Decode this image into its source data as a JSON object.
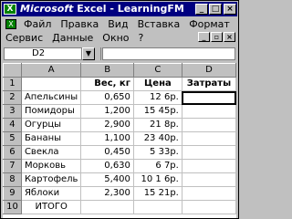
{
  "window": {
    "icon_label": "X",
    "title_brand": "Microsoft",
    "title_rest": " Excel - LearningFM",
    "btn_minimize": "_",
    "btn_maximize": "□",
    "btn_close": "×"
  },
  "menu": {
    "row1": [
      "Файл",
      "Правка",
      "Вид",
      "Вставка",
      "Формат"
    ],
    "row2": [
      "Сервис",
      "Данные",
      "Окно",
      "?"
    ],
    "doc_icon_label": "X",
    "mdi_minimize": "_",
    "mdi_restore": "▫",
    "mdi_close": "×"
  },
  "formula_bar": {
    "name_box": "D2",
    "dropdown_icon": "▼",
    "formula": ""
  },
  "grid": {
    "columns": [
      "A",
      "B",
      "C",
      "D"
    ],
    "rows": [
      {
        "num": "1",
        "cells": [
          "",
          "Вес, кг",
          "Цена",
          "Затраты"
        ]
      },
      {
        "num": "2",
        "cells": [
          "Апельсины",
          "0,650",
          "12 6р.",
          ""
        ]
      },
      {
        "num": "3",
        "cells": [
          "Помидоры",
          "1,200",
          "15 45р.",
          ""
        ]
      },
      {
        "num": "4",
        "cells": [
          "Огурцы",
          "2,900",
          "21 8р.",
          ""
        ]
      },
      {
        "num": "5",
        "cells": [
          "Бананы",
          "1,100",
          "23 40р.",
          ""
        ]
      },
      {
        "num": "6",
        "cells": [
          "Свекла",
          "0,450",
          "5 33р.",
          ""
        ]
      },
      {
        "num": "7",
        "cells": [
          "Морковь",
          "0,630",
          "6 7р.",
          ""
        ]
      },
      {
        "num": "8",
        "cells": [
          "Картофель",
          "5,400",
          "10 1 6р.",
          ""
        ]
      },
      {
        "num": "9",
        "cells": [
          "Яблоки",
          "2,300",
          "15 21р.",
          ""
        ]
      },
      {
        "num": "10",
        "cells": [
          "ИТОГО",
          "",
          "",
          ""
        ]
      }
    ]
  }
}
